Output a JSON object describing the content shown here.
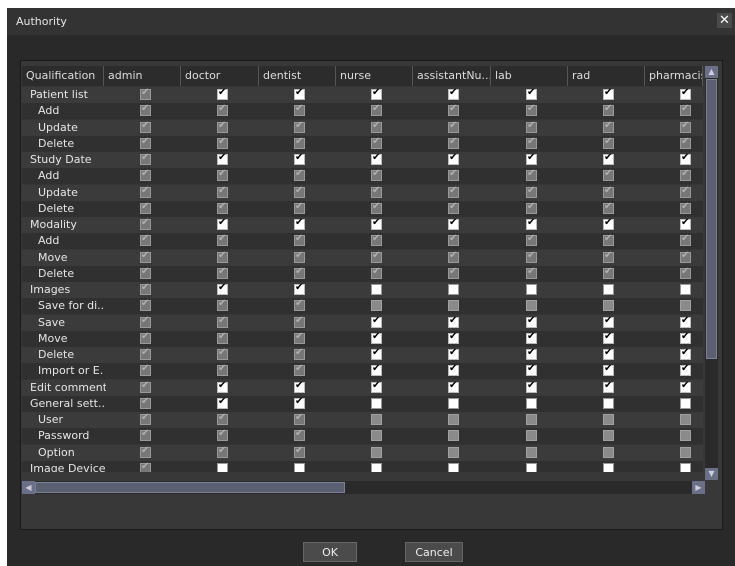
{
  "window": {
    "title": "Authority",
    "close_icon": "close-icon"
  },
  "columns": [
    "Qualification",
    "admin",
    "doctor",
    "dentist",
    "nurse",
    "assistantNu...",
    "lab",
    "rad",
    "pharmacis"
  ],
  "rows": [
    {
      "label": "Patient list",
      "indent": false,
      "states": [
        "dim",
        "on",
        "on",
        "on",
        "on",
        "on",
        "on",
        "on"
      ]
    },
    {
      "label": "Add",
      "indent": true,
      "states": [
        "dim",
        "dim",
        "dim",
        "dim",
        "dim",
        "dim",
        "dim",
        "dim"
      ]
    },
    {
      "label": "Update",
      "indent": true,
      "states": [
        "dim",
        "dim",
        "dim",
        "dim",
        "dim",
        "dim",
        "dim",
        "dim"
      ]
    },
    {
      "label": "Delete",
      "indent": true,
      "states": [
        "dim",
        "dim",
        "dim",
        "dim",
        "dim",
        "dim",
        "dim",
        "dim"
      ]
    },
    {
      "label": "Study Date",
      "indent": false,
      "states": [
        "dim",
        "on",
        "on",
        "on",
        "on",
        "on",
        "on",
        "on"
      ]
    },
    {
      "label": "Add",
      "indent": true,
      "states": [
        "dim",
        "dim",
        "dim",
        "dim",
        "dim",
        "dim",
        "dim",
        "dim"
      ]
    },
    {
      "label": "Update",
      "indent": true,
      "states": [
        "dim",
        "dim",
        "dim",
        "dim",
        "dim",
        "dim",
        "dim",
        "dim"
      ]
    },
    {
      "label": "Delete",
      "indent": true,
      "states": [
        "dim",
        "dim",
        "dim",
        "dim",
        "dim",
        "dim",
        "dim",
        "dim"
      ]
    },
    {
      "label": "Modality",
      "indent": false,
      "states": [
        "dim",
        "on",
        "on",
        "on",
        "on",
        "on",
        "on",
        "on"
      ]
    },
    {
      "label": "Add",
      "indent": true,
      "states": [
        "dim",
        "dim",
        "dim",
        "dim",
        "dim",
        "dim",
        "dim",
        "dim"
      ]
    },
    {
      "label": "Move",
      "indent": true,
      "states": [
        "dim",
        "dim",
        "dim",
        "dim",
        "dim",
        "dim",
        "dim",
        "dim"
      ]
    },
    {
      "label": "Delete",
      "indent": true,
      "states": [
        "dim",
        "dim",
        "dim",
        "dim",
        "dim",
        "dim",
        "dim",
        "dim"
      ]
    },
    {
      "label": "Images",
      "indent": false,
      "states": [
        "dim",
        "on",
        "on",
        "empty",
        "empty",
        "empty",
        "empty",
        "empty"
      ]
    },
    {
      "label": "Save for di...",
      "indent": true,
      "states": [
        "dim",
        "dim",
        "dim",
        "grey",
        "grey",
        "grey",
        "grey",
        "grey"
      ]
    },
    {
      "label": "Save",
      "indent": true,
      "states": [
        "dim",
        "dim",
        "dim",
        "on",
        "on",
        "on",
        "on",
        "on"
      ]
    },
    {
      "label": "Move",
      "indent": true,
      "states": [
        "dim",
        "dim",
        "dim",
        "on",
        "on",
        "on",
        "on",
        "on"
      ]
    },
    {
      "label": "Delete",
      "indent": true,
      "states": [
        "dim",
        "dim",
        "dim",
        "on",
        "on",
        "on",
        "on",
        "on"
      ]
    },
    {
      "label": "Import or E...",
      "indent": true,
      "states": [
        "dim",
        "dim",
        "dim",
        "on",
        "on",
        "on",
        "on",
        "on"
      ]
    },
    {
      "label": "Edit comment",
      "indent": false,
      "states": [
        "dim",
        "on",
        "on",
        "on",
        "on",
        "on",
        "on",
        "on"
      ]
    },
    {
      "label": "General sett...",
      "indent": false,
      "states": [
        "dim",
        "on",
        "on",
        "empty",
        "empty",
        "empty",
        "empty",
        "empty"
      ]
    },
    {
      "label": "User",
      "indent": true,
      "states": [
        "dim",
        "dim",
        "dim",
        "grey",
        "grey",
        "grey",
        "grey",
        "grey"
      ]
    },
    {
      "label": "Password",
      "indent": true,
      "states": [
        "dim",
        "dim",
        "dim",
        "grey",
        "grey",
        "grey",
        "grey",
        "grey"
      ]
    },
    {
      "label": "Option",
      "indent": true,
      "states": [
        "dim",
        "dim",
        "dim",
        "grey",
        "grey",
        "grey",
        "grey",
        "grey"
      ]
    },
    {
      "label": "Image Device",
      "indent": false,
      "states": [
        "dim",
        "empty",
        "empty",
        "empty",
        "empty",
        "empty",
        "empty",
        "empty"
      ]
    }
  ],
  "buttons": {
    "ok": "OK",
    "cancel": "Cancel"
  }
}
